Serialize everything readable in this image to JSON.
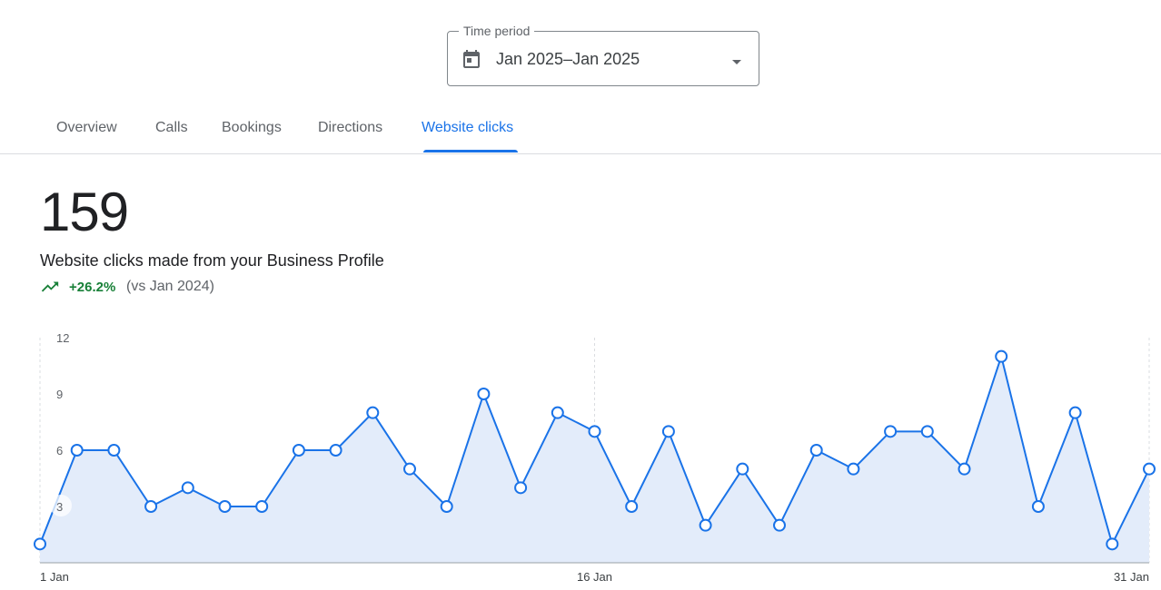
{
  "period": {
    "label": "Time period",
    "value": "Jan 2025–Jan 2025",
    "calendar_icon": "calendar-icon",
    "caret_icon": "dropdown-arrow-icon"
  },
  "tabs": [
    {
      "label": "Overview",
      "active": false
    },
    {
      "label": "Calls",
      "active": false
    },
    {
      "label": "Bookings",
      "active": false
    },
    {
      "label": "Directions",
      "active": false
    },
    {
      "label": "Website clicks",
      "active": true
    }
  ],
  "metric": {
    "value": "159",
    "description": "Website clicks made from your Business Profile",
    "trend_icon": "trending-up-icon",
    "change": "+26.2%",
    "comparison": "(vs Jan 2024)"
  },
  "colors": {
    "accent": "#1a73e8",
    "positive": "#188038",
    "area_fill": "#e3ecfa"
  },
  "chart_data": {
    "type": "area",
    "x": [
      "1 Jan",
      "2 Jan",
      "3 Jan",
      "4 Jan",
      "5 Jan",
      "6 Jan",
      "7 Jan",
      "8 Jan",
      "9 Jan",
      "10 Jan",
      "11 Jan",
      "12 Jan",
      "13 Jan",
      "14 Jan",
      "15 Jan",
      "16 Jan",
      "17 Jan",
      "18 Jan",
      "19 Jan",
      "20 Jan",
      "21 Jan",
      "22 Jan",
      "23 Jan",
      "24 Jan",
      "25 Jan",
      "26 Jan",
      "27 Jan",
      "28 Jan",
      "29 Jan",
      "30 Jan",
      "31 Jan"
    ],
    "values": [
      1,
      6,
      6,
      3,
      4,
      3,
      3,
      6,
      6,
      8,
      5,
      3,
      9,
      4,
      8,
      7,
      3,
      7,
      2,
      5,
      2,
      6,
      5,
      7,
      7,
      5,
      11,
      3,
      8,
      1,
      5
    ],
    "yticks": [
      3,
      6,
      9,
      12
    ],
    "ylim": [
      0,
      12
    ],
    "xtick_labels": [
      "1 Jan",
      "16 Jan",
      "31 Jan"
    ],
    "grid": "vertical dashed at labeled dates",
    "markers": "hollow circles"
  }
}
